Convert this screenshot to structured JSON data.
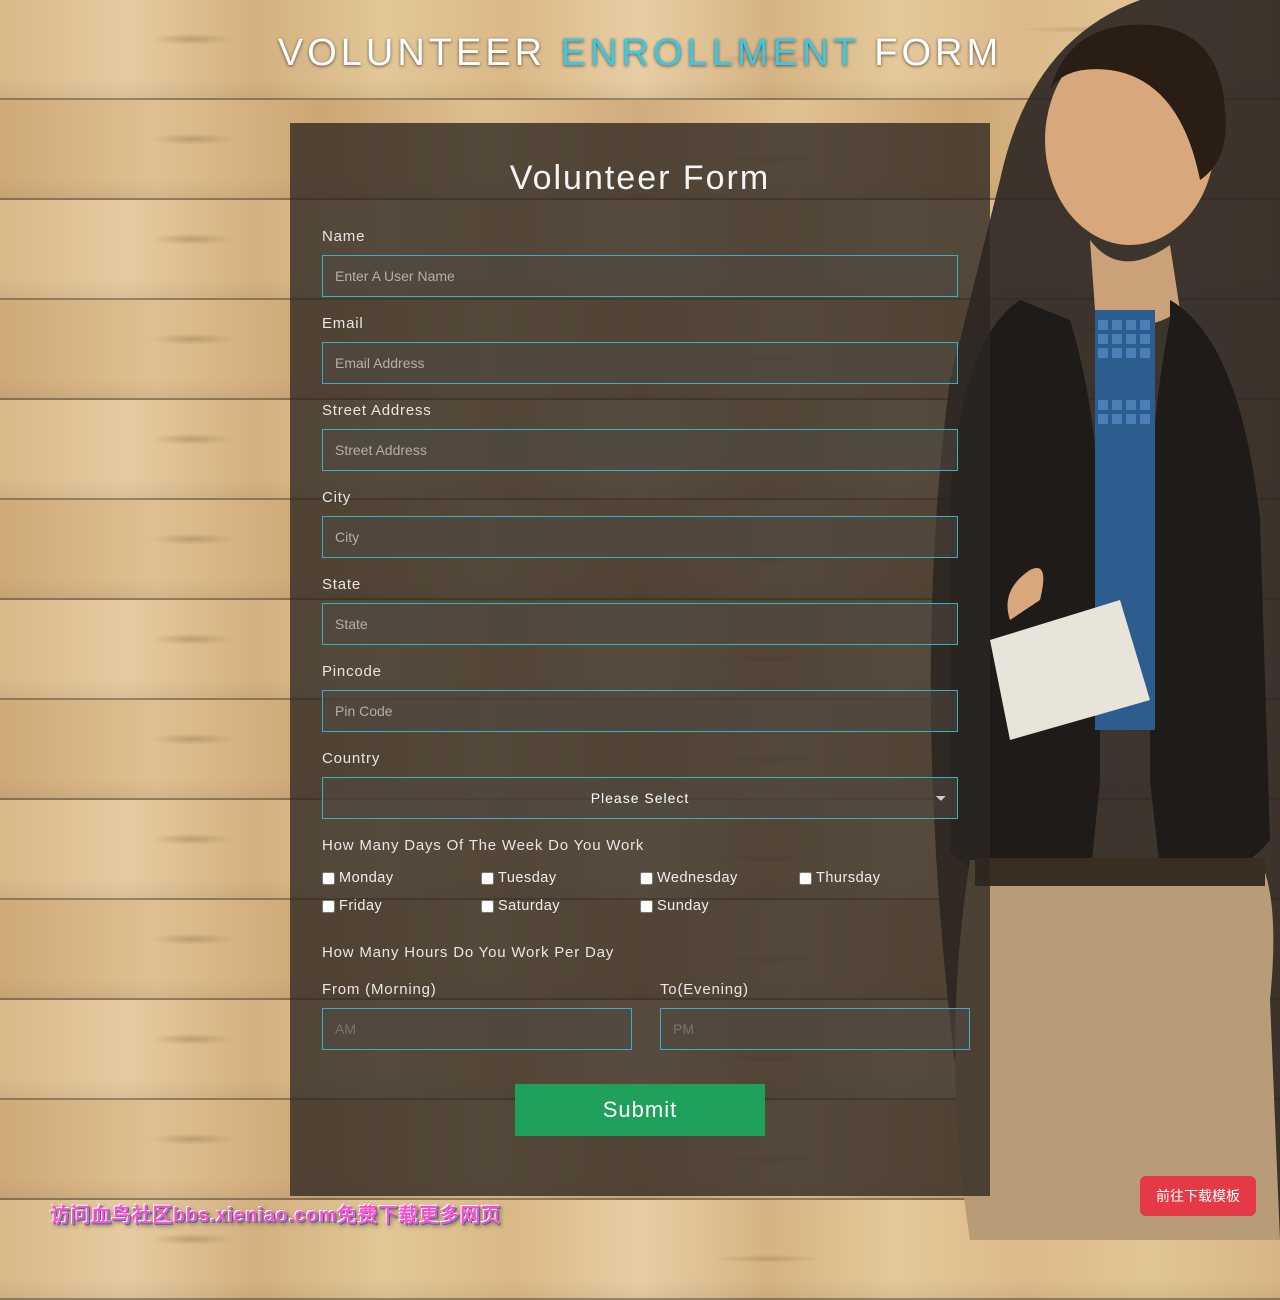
{
  "page_title": {
    "pre": "VOLUNTEER ",
    "accent": "ENROLLMENT",
    "post": " FORM"
  },
  "card": {
    "heading": "Volunteer Form",
    "fields": {
      "name": {
        "label": "Name",
        "placeholder": "Enter A User Name"
      },
      "email": {
        "label": "Email",
        "placeholder": "Email Address"
      },
      "street": {
        "label": "Street Address",
        "placeholder": "Street Address"
      },
      "city": {
        "label": "City",
        "placeholder": "City"
      },
      "state": {
        "label": "State",
        "placeholder": "State"
      },
      "pincode": {
        "label": "Pincode",
        "placeholder": "Pin Code"
      },
      "country": {
        "label": "Country",
        "option": "Please Select"
      }
    },
    "days_question": "How Many Days Of The Week Do You Work",
    "days": [
      "Monday",
      "Tuesday",
      "Wednesday",
      "Thursday",
      "Friday",
      "Saturday",
      "Sunday"
    ],
    "hours_question": "How Many Hours Do You Work Per Day",
    "hours": {
      "from": {
        "label": "From (Morning)",
        "placeholder": "AM"
      },
      "to": {
        "label": "To(Evening)",
        "placeholder": "PM"
      }
    },
    "submit": "Submit"
  },
  "watermark": "访问血鸟社区bbs.xieniao.com免费下载更多网页",
  "download_button": "前往下载模板"
}
